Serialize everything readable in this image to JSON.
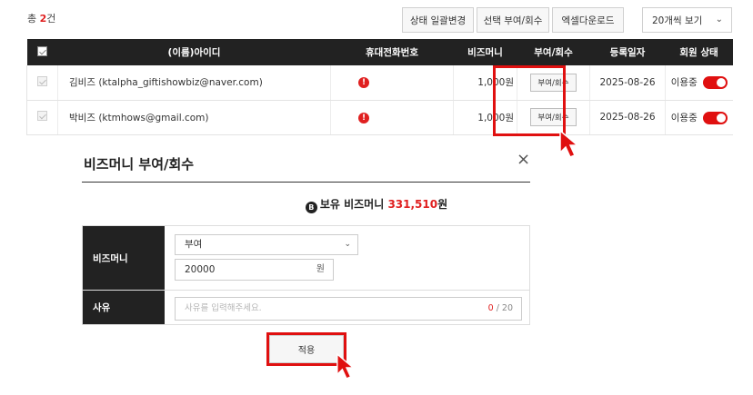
{
  "toolbar": {
    "total_prefix": "총 ",
    "total_count": "2",
    "total_suffix": "건",
    "bulk_status_button": "상태 일괄변경",
    "grant_selected_button": "선택 부여/회수",
    "excel_button": "엑셀다운로드",
    "page_size": "20개씩 보기"
  },
  "table": {
    "headers": [
      "(이름)아이디",
      "휴대전화번호",
      "비즈머니",
      "부여/회수",
      "등록일자",
      "회원 상태"
    ],
    "rows": [
      {
        "name": "김비즈 (ktalpha_giftishowbiz@naver.com)",
        "bizmoney": "1,000원",
        "action": "부여/회수",
        "date": "2025-08-26",
        "status": "이용중"
      },
      {
        "name": "박비즈 (ktmhows@gmail.com)",
        "bizmoney": "1,000원",
        "action": "부여/회수",
        "date": "2025-08-26",
        "status": "이용중"
      }
    ]
  },
  "modal": {
    "title": "비즈머니 부여/회수",
    "close": "×",
    "balance_label": "보유 비즈머니 ",
    "balance_amount": "331,510",
    "balance_unit": "원",
    "coin_glyph": "B",
    "form": {
      "bizmoney_label": "비즈머니",
      "type_value": "부여",
      "amount_value": "20000",
      "amount_unit": "원",
      "reason_label": "사유",
      "reason_placeholder": "사유를 입력해주세요.",
      "reason_count": "0",
      "reason_max": "/ 20"
    },
    "apply_button": "적용"
  },
  "colors": {
    "accent": "#e02020",
    "header_bg": "#222222",
    "highlight": "#e01010"
  }
}
